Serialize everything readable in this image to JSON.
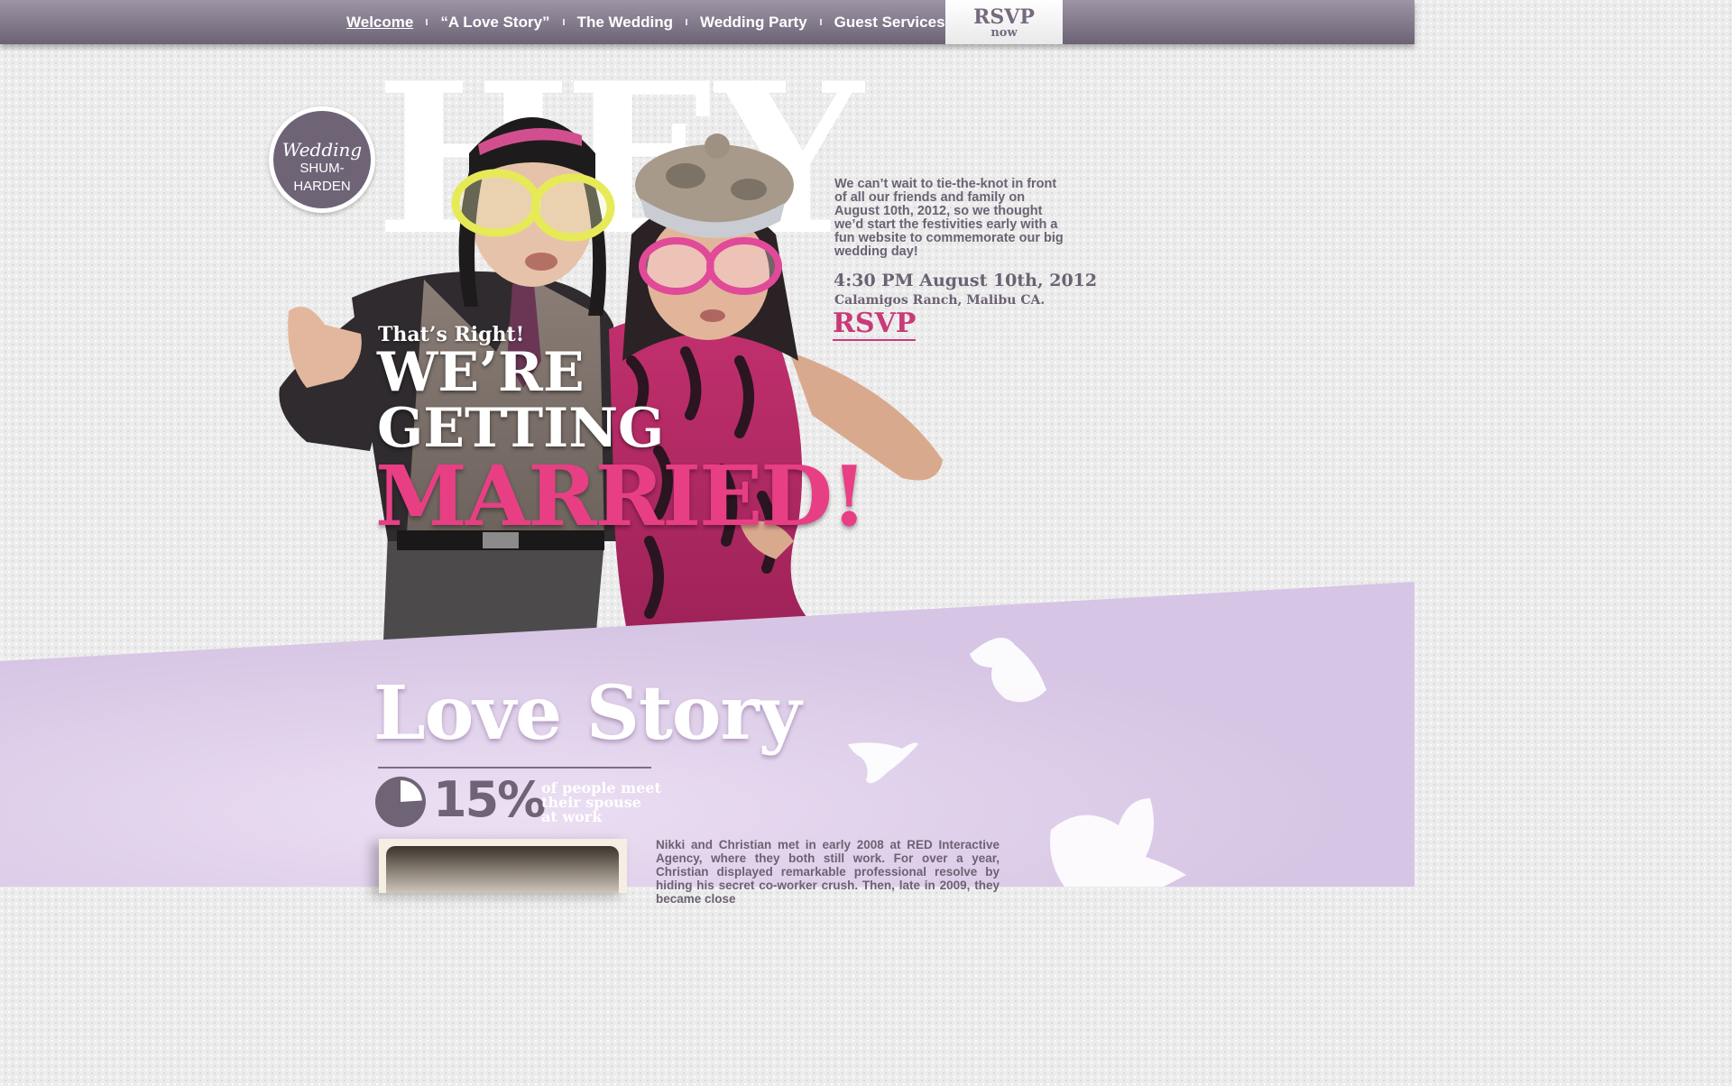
{
  "nav": {
    "items": [
      {
        "label": "Welcome"
      },
      {
        "label": "“A Love Story”"
      },
      {
        "label": "The Wedding"
      },
      {
        "label": "Wedding Party"
      },
      {
        "label": "Guest Services"
      }
    ],
    "rsvp_big": "RSVP",
    "rsvp_small": "now"
  },
  "hero": {
    "backdrop_word": "HEY",
    "badge_script": "Wedding",
    "badge_name": "SHUM-HARDEN",
    "thats_right": "That’s Right!",
    "line1": "WE’RE",
    "line2": "GETTING",
    "line3": "MARRIED!",
    "intro": "We can’t wait to tie-the-knot in front of all our friends and family on August 10th, 2012, so we thought we’d start the festivities early with a fun website to commemorate our big wedding day!",
    "datetime": "4:30 PM August 10th, 2012",
    "venue": "Calamigos Ranch, Malibu CA.",
    "rsvp_link": "RSVP"
  },
  "love_story": {
    "title": "Love Story",
    "stat_value": "15%",
    "stat_fraction": 0.15,
    "stat_text_1": "of people meet",
    "stat_text_2": "their spouse",
    "stat_text_3": "at work",
    "body": "Nikki and Christian met in early 2008 at RED Interactive Agency, where they both still work. For over a year, Christian displayed remarkable professional resolve by hiding his secret co-worker crush. Then, late in 2009, they became close"
  },
  "colors": {
    "nav_top": "#9d94a6",
    "nav_bottom": "#6c6274",
    "accent_pink": "#e83f84",
    "text_purple": "#6b6273",
    "lavender": "#d8c9e6"
  }
}
